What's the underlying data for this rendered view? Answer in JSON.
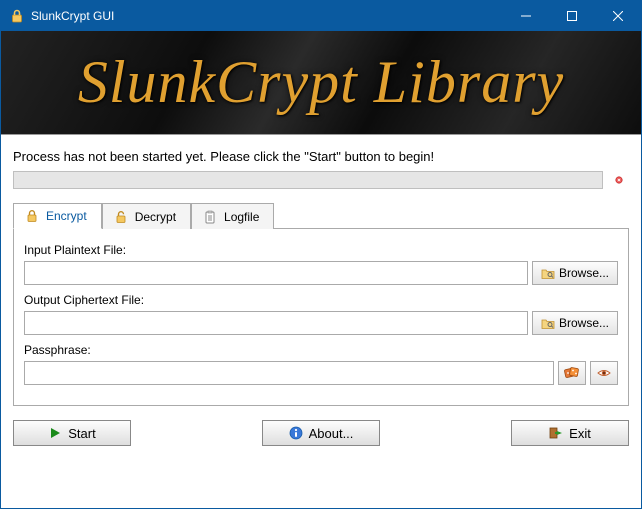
{
  "window": {
    "title": "SlunkCrypt GUI",
    "banner_text": "SlunkCrypt Library"
  },
  "status": {
    "message": "Process has not been started yet. Please click the \"Start\" button to begin!"
  },
  "tabs": {
    "encrypt": "Encrypt",
    "decrypt": "Decrypt",
    "logfile": "Logfile"
  },
  "encrypt_panel": {
    "input_label": "Input Plaintext File:",
    "input_value": "",
    "output_label": "Output Ciphertext File:",
    "output_value": "",
    "passphrase_label": "Passphrase:",
    "passphrase_value": "",
    "browse_label": "Browse..."
  },
  "footer": {
    "start": "Start",
    "about": "About...",
    "exit": "Exit"
  }
}
